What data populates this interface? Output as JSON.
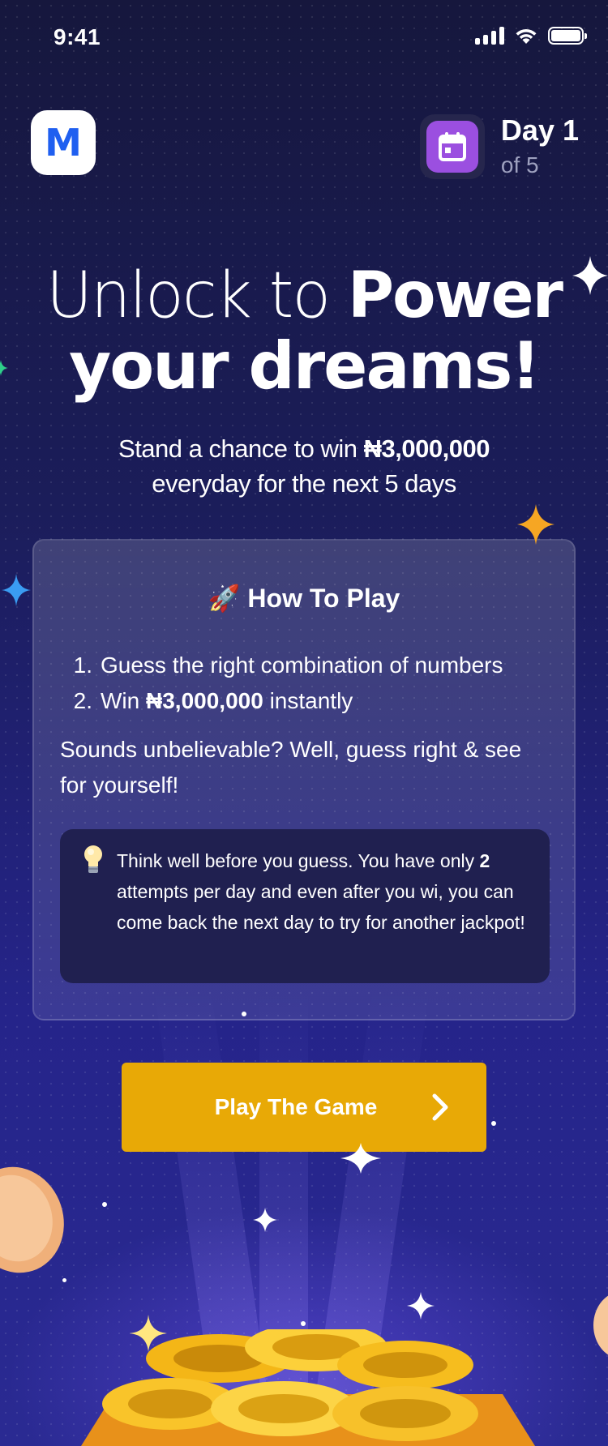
{
  "status_bar": {
    "time": "9:41"
  },
  "header": {
    "logo_letter": "M",
    "day_title": "Day 1",
    "day_subtitle": "of 5"
  },
  "hero": {
    "headline_part1": "Unlock to ",
    "headline_part2": "Power",
    "headline_line2": "your dreams!",
    "sub_prefix": "Stand a chance to win ",
    "sub_amount": "₦3,000,000",
    "sub_line2": "everyday for the next 5 days"
  },
  "how_to_play": {
    "title": "🚀 How To Play",
    "steps": [
      {
        "num": "1.",
        "text": "Guess the right combination of numbers"
      },
      {
        "num": "2.",
        "text_prefix": "Win ",
        "text_bold": "₦3,000,000",
        "text_suffix": " instantly"
      }
    ],
    "note": "Sounds unbelievable? Well, guess right & see for yourself!",
    "tip_prefix": "Think well before you guess. You have only ",
    "tip_bold": "2",
    "tip_suffix": " attempts per day and even after you wi, you can come back the next day to try for another jackpot!"
  },
  "cta": {
    "label": "Play The Game"
  },
  "colors": {
    "background_top": "#16173d",
    "background_bottom": "#2a2a92",
    "button": "#e8a906",
    "calendar_accent": "#9b4fe0",
    "logo_blue": "#1f5ff0"
  },
  "icons": [
    "cellular-signal-icon",
    "wifi-icon",
    "battery-icon",
    "calendar-icon",
    "lightbulb-icon",
    "chevron-right-icon"
  ]
}
